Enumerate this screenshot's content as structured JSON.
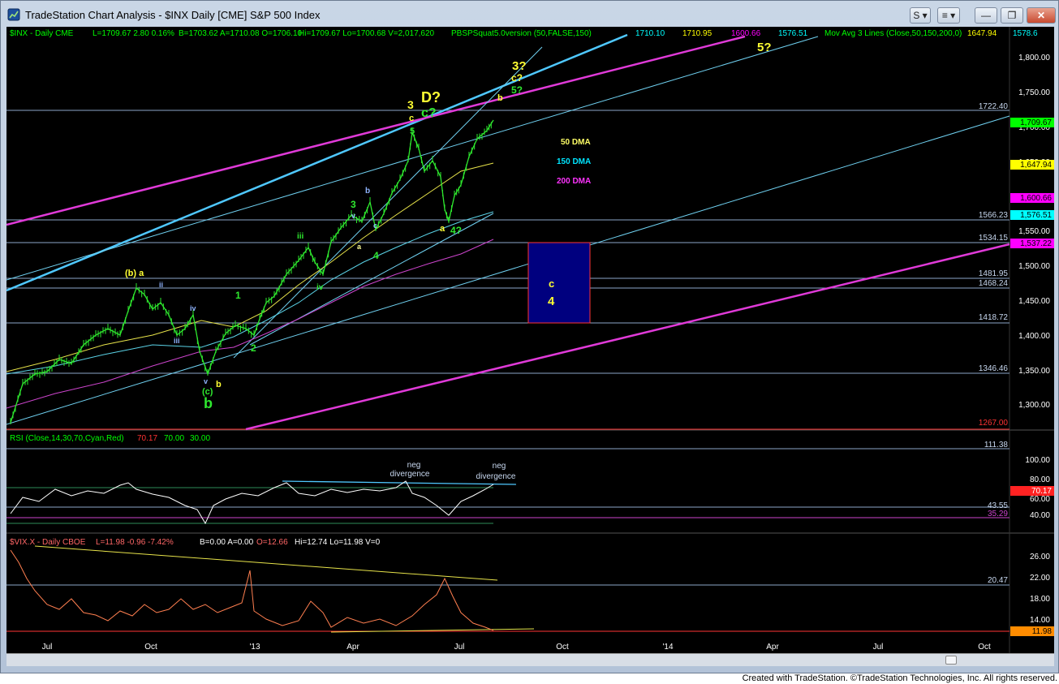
{
  "window": {
    "title": "TradeStation Chart Analysis - $INX Daily [CME] S&P 500 Index"
  },
  "titlebar_buttons": {
    "symbol_btn": "S",
    "menu_btn": "≡",
    "minimize": "—",
    "restore": "❐",
    "close": "✕"
  },
  "header1": {
    "items": [
      {
        "text": "$INX - Daily  CME",
        "color": "#00ff00"
      },
      {
        "text": "L=1709.67  2.80  0.16%",
        "color": "#00ff00"
      },
      {
        "text": "B=1703.62  A=1710.08  O=1706.10",
        "color": "#00ff00"
      },
      {
        "text": "Hi=1709.67  Lo=1700.68  V=2,017,620",
        "color": "#00ff00"
      },
      {
        "text": "PBSPSquat5.0version (50,FALSE,150)",
        "color": "#00ff00"
      },
      {
        "text": "1710.10",
        "color": "#00ffff"
      },
      {
        "text": "1710.95",
        "color": "#ffff00"
      },
      {
        "text": "1600.66",
        "color": "#ff00ff"
      },
      {
        "text": "1576.51",
        "color": "#00ffff"
      },
      {
        "text": "Mov Avg 3 Lines (Close,50,150,200,0)",
        "color": "#00ff00"
      },
      {
        "text": "1647.94",
        "color": "#ffff00"
      },
      {
        "text": "1578.6",
        "color": "#00ffff"
      }
    ]
  },
  "price_axis": {
    "ticks": [
      "1,800.00",
      "1,750.00",
      "1,700.00",
      "1,650.00",
      "1,600.00",
      "1,550.00",
      "1,500.00",
      "1,450.00",
      "1,400.00",
      "1,350.00",
      "1,300.00"
    ],
    "levels": [
      "1722.40",
      "1566.23",
      "1534.15",
      "1481.95",
      "1468.24",
      "1418.72",
      "1346.46",
      "1267.00"
    ],
    "badges": [
      {
        "text": "1,709.67",
        "bg": "#00ff00",
        "fg": "#000000"
      },
      {
        "text": "1,647.94",
        "bg": "#ffff00",
        "fg": "#000000"
      },
      {
        "text": "1,600.66",
        "bg": "#ff00ff",
        "fg": "#000000"
      },
      {
        "text": "1,576.51",
        "bg": "#00ffff",
        "fg": "#000000"
      },
      {
        "text": "1,537.22",
        "bg": "#ff00ff",
        "fg": "#000000"
      }
    ]
  },
  "wave_labels": [
    "3?",
    "c?",
    "5?",
    "5?",
    "3",
    "c",
    "D?",
    "c?",
    "5",
    "b",
    "a",
    "4?",
    "b",
    "3",
    "v",
    "c",
    "4",
    "a",
    "iii",
    "iv",
    "(b) a",
    "ii",
    "iv",
    "iii",
    "1",
    "2",
    "v",
    "b",
    "(c)",
    "b",
    "c",
    "4"
  ],
  "ma_legend": [
    {
      "text": "50 DMA",
      "color": "#ffff66"
    },
    {
      "text": "150 DMA",
      "color": "#00e5ff"
    },
    {
      "text": "200 DMA",
      "color": "#ff33ff"
    }
  ],
  "rsi": {
    "header": "RSI (Close,14,30,70,Cyan,Red)",
    "values": [
      {
        "text": "70.17",
        "color": "#ff3333"
      },
      {
        "text": "70.00",
        "color": "#00ff00"
      },
      {
        "text": "30.00",
        "color": "#00ff00"
      }
    ],
    "ticks": [
      "100.00",
      "80.00",
      "60.00",
      "40.00"
    ],
    "levels": [
      "111.38",
      "43.55",
      "35.29"
    ],
    "badge": "70.17",
    "annotations": [
      {
        "line1": "neg",
        "line2": "divergence"
      },
      {
        "line1": "neg",
        "line2": "divergence"
      }
    ]
  },
  "vix": {
    "header_items": [
      {
        "text": "$VIX.X - Daily  CBOE",
        "color": "#ff6666"
      },
      {
        "text": "L=11.98  -0.96  -7.42%",
        "color": "#ff6666"
      },
      {
        "text": "B=0.00  A=0.00",
        "color": "#ffffff"
      },
      {
        "text": "O=12.66",
        "color": "#ff6666"
      },
      {
        "text": "Hi=12.74  Lo=11.98  V=0",
        "color": "#ffffff"
      }
    ],
    "ticks": [
      "26.00",
      "22.00",
      "18.00",
      "14.00"
    ],
    "level": "20.47",
    "badge": "11.98"
  },
  "time_axis": [
    "Jul",
    "Oct",
    "'13",
    "Apr",
    "Jul",
    "Oct",
    "'14",
    "Apr",
    "Jul",
    "Oct"
  ],
  "footer": "Created with TradeStation. ©TradeStation Technologies, Inc. All rights reserved.",
  "colors": {
    "background": "#000000",
    "price_up": "#00ff00",
    "rsi_line": "#ffffff",
    "vix_line": "#ff7f50"
  }
}
